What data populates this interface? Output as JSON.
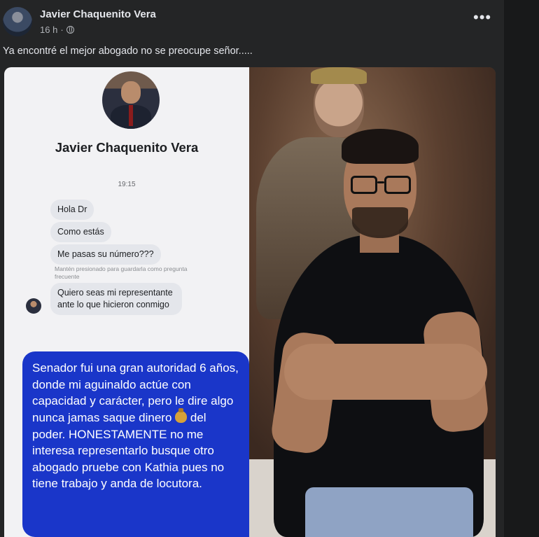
{
  "post": {
    "author": "Javier Chaquenito Vera",
    "time": "16 h",
    "separator": "·",
    "caption": "Ya encontré el mejor abogado no se preocupe señor.....",
    "more_label": "•••"
  },
  "chat": {
    "contact_name": "Javier Chaquenito Vera",
    "time": "19:15",
    "messages": [
      "Hola Dr",
      "Como estás",
      "Me pasas su número???",
      "Quiero seas mi representante ante lo que hicieron conmigo"
    ],
    "hint": "Mantén presionado para guardarla como pregunta frecuente",
    "reply_part1": "Senador fui una gran autoridad 6 años,  donde mi aguinaldo actúe con capacidad y carácter, pero le dire algo nunca jamas saque dinero",
    "reply_emoji": "money-bag-emoji",
    "reply_part2": "del poder. HONESTAMENTE no me interesa representarlo busque otro abogado pruebe con Kathia pues no tiene trabajo y anda de locutora."
  },
  "colors": {
    "background": "#18191a",
    "card": "#242526",
    "reply_bubble": "#1a36c9",
    "incoming_bubble": "#e4e6eb"
  }
}
